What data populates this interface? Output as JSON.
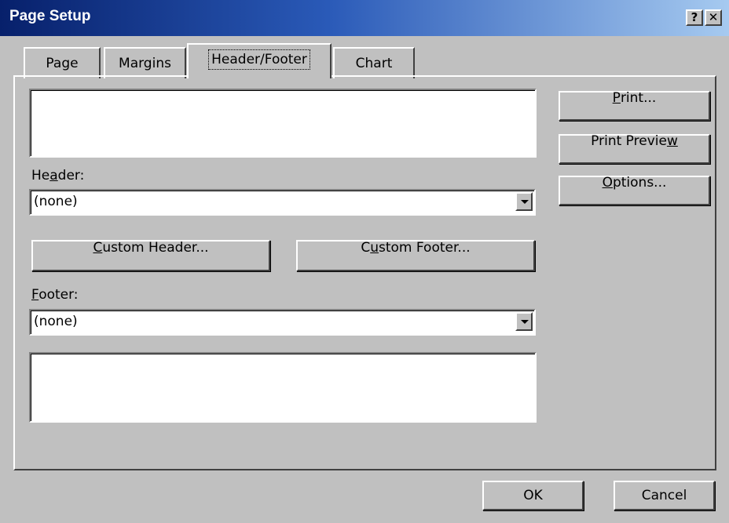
{
  "window": {
    "title": "Page Setup",
    "help_glyph": "?",
    "close_glyph": "✕"
  },
  "tabs": [
    {
      "label": "Page"
    },
    {
      "label": "Margins"
    },
    {
      "label": "Header/Footer",
      "active": true
    },
    {
      "label": "Chart"
    }
  ],
  "header": {
    "label_pre": "He",
    "label_key": "a",
    "label_post": "der:",
    "value": "(none)"
  },
  "footer": {
    "label_key": "F",
    "label_post": "ooter:",
    "value": "(none)"
  },
  "buttons": {
    "custom_header_key": "C",
    "custom_header_rest": "ustom Header...",
    "custom_footer_pre": "C",
    "custom_footer_key": "u",
    "custom_footer_rest": "stom Footer...",
    "print_key": "P",
    "print_rest": "rint...",
    "print_preview_pre": "Print Previe",
    "print_preview_key": "w",
    "options_key": "O",
    "options_rest": "ptions...",
    "ok": "OK",
    "cancel": "Cancel"
  }
}
